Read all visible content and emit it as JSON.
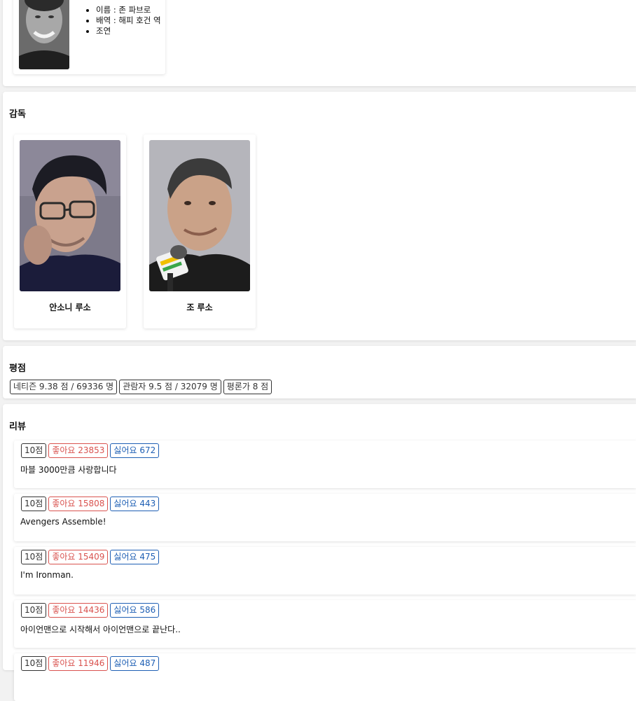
{
  "cast": {
    "info_items": [
      "이름 : 존 파브로",
      "배역 : 해피 호건 역",
      "조연"
    ]
  },
  "directors": {
    "title": "감독",
    "items": [
      {
        "name": "안소니 루소"
      },
      {
        "name": "조 루소"
      }
    ]
  },
  "ratings": {
    "title": "평점",
    "netizen": "네티즌 9.38 점 / 69336 명",
    "audience": "관람자 9.5 점 / 32079 명",
    "critic": "평론가 8 점"
  },
  "reviews": {
    "title": "리뷰",
    "items": [
      {
        "score": "10점",
        "likes": "좋아요 23853",
        "dislikes": "싫어요 672",
        "text": "마블 3000만큼 사랑합니다"
      },
      {
        "score": "10점",
        "likes": "좋아요 15808",
        "dislikes": "싫어요 443",
        "text": "Avengers Assemble!"
      },
      {
        "score": "10점",
        "likes": "좋아요 15409",
        "dislikes": "싫어요 475",
        "text": "I'm Ironman."
      },
      {
        "score": "10점",
        "likes": "좋아요 14436",
        "dislikes": "싫어요 586",
        "text": "아이언맨으로 시작해서 아이언맨으로 끝난다.."
      },
      {
        "score": "10점",
        "likes": "좋아요 11946",
        "dislikes": "싫어요 487",
        "text": ""
      }
    ]
  },
  "colors": {
    "like": "#d9534f",
    "dislike": "#1e5fb4",
    "neutral": "#333333"
  }
}
